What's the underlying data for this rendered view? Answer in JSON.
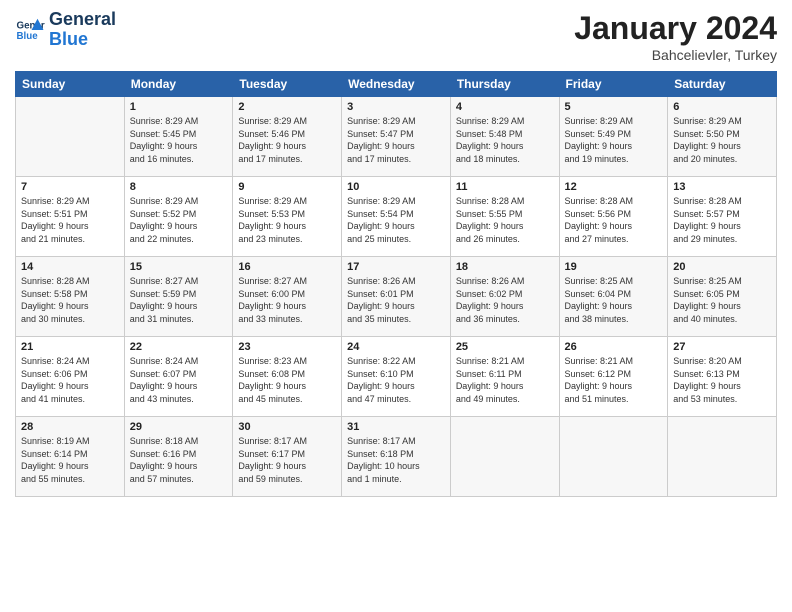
{
  "header": {
    "logo_line1": "General",
    "logo_line2": "Blue",
    "month": "January 2024",
    "location": "Bahcelievler, Turkey"
  },
  "days_of_week": [
    "Sunday",
    "Monday",
    "Tuesday",
    "Wednesday",
    "Thursday",
    "Friday",
    "Saturday"
  ],
  "weeks": [
    [
      {
        "day": "",
        "lines": []
      },
      {
        "day": "1",
        "lines": [
          "Sunrise: 8:29 AM",
          "Sunset: 5:45 PM",
          "Daylight: 9 hours",
          "and 16 minutes."
        ]
      },
      {
        "day": "2",
        "lines": [
          "Sunrise: 8:29 AM",
          "Sunset: 5:46 PM",
          "Daylight: 9 hours",
          "and 17 minutes."
        ]
      },
      {
        "day": "3",
        "lines": [
          "Sunrise: 8:29 AM",
          "Sunset: 5:47 PM",
          "Daylight: 9 hours",
          "and 17 minutes."
        ]
      },
      {
        "day": "4",
        "lines": [
          "Sunrise: 8:29 AM",
          "Sunset: 5:48 PM",
          "Daylight: 9 hours",
          "and 18 minutes."
        ]
      },
      {
        "day": "5",
        "lines": [
          "Sunrise: 8:29 AM",
          "Sunset: 5:49 PM",
          "Daylight: 9 hours",
          "and 19 minutes."
        ]
      },
      {
        "day": "6",
        "lines": [
          "Sunrise: 8:29 AM",
          "Sunset: 5:50 PM",
          "Daylight: 9 hours",
          "and 20 minutes."
        ]
      }
    ],
    [
      {
        "day": "7",
        "lines": [
          "Sunrise: 8:29 AM",
          "Sunset: 5:51 PM",
          "Daylight: 9 hours",
          "and 21 minutes."
        ]
      },
      {
        "day": "8",
        "lines": [
          "Sunrise: 8:29 AM",
          "Sunset: 5:52 PM",
          "Daylight: 9 hours",
          "and 22 minutes."
        ]
      },
      {
        "day": "9",
        "lines": [
          "Sunrise: 8:29 AM",
          "Sunset: 5:53 PM",
          "Daylight: 9 hours",
          "and 23 minutes."
        ]
      },
      {
        "day": "10",
        "lines": [
          "Sunrise: 8:29 AM",
          "Sunset: 5:54 PM",
          "Daylight: 9 hours",
          "and 25 minutes."
        ]
      },
      {
        "day": "11",
        "lines": [
          "Sunrise: 8:28 AM",
          "Sunset: 5:55 PM",
          "Daylight: 9 hours",
          "and 26 minutes."
        ]
      },
      {
        "day": "12",
        "lines": [
          "Sunrise: 8:28 AM",
          "Sunset: 5:56 PM",
          "Daylight: 9 hours",
          "and 27 minutes."
        ]
      },
      {
        "day": "13",
        "lines": [
          "Sunrise: 8:28 AM",
          "Sunset: 5:57 PM",
          "Daylight: 9 hours",
          "and 29 minutes."
        ]
      }
    ],
    [
      {
        "day": "14",
        "lines": [
          "Sunrise: 8:28 AM",
          "Sunset: 5:58 PM",
          "Daylight: 9 hours",
          "and 30 minutes."
        ]
      },
      {
        "day": "15",
        "lines": [
          "Sunrise: 8:27 AM",
          "Sunset: 5:59 PM",
          "Daylight: 9 hours",
          "and 31 minutes."
        ]
      },
      {
        "day": "16",
        "lines": [
          "Sunrise: 8:27 AM",
          "Sunset: 6:00 PM",
          "Daylight: 9 hours",
          "and 33 minutes."
        ]
      },
      {
        "day": "17",
        "lines": [
          "Sunrise: 8:26 AM",
          "Sunset: 6:01 PM",
          "Daylight: 9 hours",
          "and 35 minutes."
        ]
      },
      {
        "day": "18",
        "lines": [
          "Sunrise: 8:26 AM",
          "Sunset: 6:02 PM",
          "Daylight: 9 hours",
          "and 36 minutes."
        ]
      },
      {
        "day": "19",
        "lines": [
          "Sunrise: 8:25 AM",
          "Sunset: 6:04 PM",
          "Daylight: 9 hours",
          "and 38 minutes."
        ]
      },
      {
        "day": "20",
        "lines": [
          "Sunrise: 8:25 AM",
          "Sunset: 6:05 PM",
          "Daylight: 9 hours",
          "and 40 minutes."
        ]
      }
    ],
    [
      {
        "day": "21",
        "lines": [
          "Sunrise: 8:24 AM",
          "Sunset: 6:06 PM",
          "Daylight: 9 hours",
          "and 41 minutes."
        ]
      },
      {
        "day": "22",
        "lines": [
          "Sunrise: 8:24 AM",
          "Sunset: 6:07 PM",
          "Daylight: 9 hours",
          "and 43 minutes."
        ]
      },
      {
        "day": "23",
        "lines": [
          "Sunrise: 8:23 AM",
          "Sunset: 6:08 PM",
          "Daylight: 9 hours",
          "and 45 minutes."
        ]
      },
      {
        "day": "24",
        "lines": [
          "Sunrise: 8:22 AM",
          "Sunset: 6:10 PM",
          "Daylight: 9 hours",
          "and 47 minutes."
        ]
      },
      {
        "day": "25",
        "lines": [
          "Sunrise: 8:21 AM",
          "Sunset: 6:11 PM",
          "Daylight: 9 hours",
          "and 49 minutes."
        ]
      },
      {
        "day": "26",
        "lines": [
          "Sunrise: 8:21 AM",
          "Sunset: 6:12 PM",
          "Daylight: 9 hours",
          "and 51 minutes."
        ]
      },
      {
        "day": "27",
        "lines": [
          "Sunrise: 8:20 AM",
          "Sunset: 6:13 PM",
          "Daylight: 9 hours",
          "and 53 minutes."
        ]
      }
    ],
    [
      {
        "day": "28",
        "lines": [
          "Sunrise: 8:19 AM",
          "Sunset: 6:14 PM",
          "Daylight: 9 hours",
          "and 55 minutes."
        ]
      },
      {
        "day": "29",
        "lines": [
          "Sunrise: 8:18 AM",
          "Sunset: 6:16 PM",
          "Daylight: 9 hours",
          "and 57 minutes."
        ]
      },
      {
        "day": "30",
        "lines": [
          "Sunrise: 8:17 AM",
          "Sunset: 6:17 PM",
          "Daylight: 9 hours",
          "and 59 minutes."
        ]
      },
      {
        "day": "31",
        "lines": [
          "Sunrise: 8:17 AM",
          "Sunset: 6:18 PM",
          "Daylight: 10 hours",
          "and 1 minute."
        ]
      },
      {
        "day": "",
        "lines": []
      },
      {
        "day": "",
        "lines": []
      },
      {
        "day": "",
        "lines": []
      }
    ]
  ]
}
